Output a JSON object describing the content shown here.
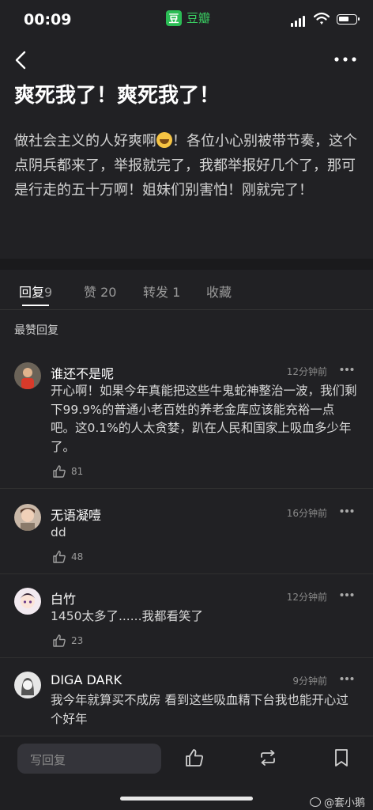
{
  "status_bar": {
    "time": "00:09",
    "app_name": "豆瓣",
    "app_logo_char": "豆",
    "accent": "#2bbd55"
  },
  "post": {
    "title": "爽死我了！爽死我了！",
    "body_part1": "做社会主义的人好爽啊",
    "body_emoji": "grinning-face-emoji",
    "body_part2": "！各位小心别被带节奏，这个点阴兵都来了，举报就完了，我都举报好几个了，那可是行走的五十万啊！姐妹们别害怕！刚就完了！"
  },
  "tabs": [
    {
      "label": "回复",
      "count": "9",
      "active": true
    },
    {
      "label": "赞",
      "count": "20",
      "active": false
    },
    {
      "label": "转发",
      "count": "1",
      "active": false
    },
    {
      "label": "收藏",
      "count": "",
      "active": false
    }
  ],
  "section_label": "最赞回复",
  "comments": [
    {
      "name": "谁还不是呢",
      "time": "12分钟前",
      "text": "开心啊！如果今年真能把这些牛鬼蛇神整治一波，我们剩下99.9%的普通小老百姓的养老金库应该能充裕一点吧。这0.1%的人太贪婪，趴在人民和国家上吸血多少年了。",
      "likes": "81"
    },
    {
      "name": "无语凝噎",
      "time": "16分钟前",
      "text": "dd",
      "likes": "48"
    },
    {
      "name": "白竹",
      "time": "12分钟前",
      "text": "1450太多了......我都看笑了",
      "likes": "23"
    },
    {
      "name": "DIGA DARK",
      "time": "9分钟前",
      "text": "我今年就算买不成房 看到这些吸血精下台我也能开心过个好年",
      "likes": ""
    }
  ],
  "bottom_bar": {
    "reply_placeholder": "写回复"
  },
  "watermark": "@套小鹅"
}
